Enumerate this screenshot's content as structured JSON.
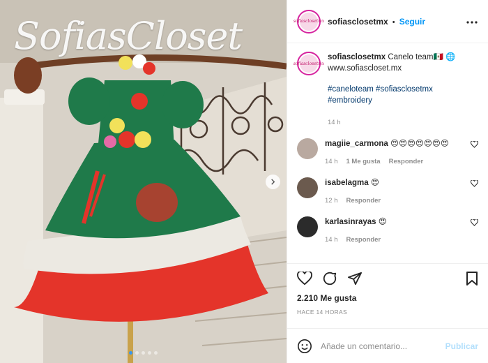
{
  "post": {
    "watermark": "SofiasCloset",
    "username": "sofiasclosetmx",
    "follow_label": "Seguir",
    "separator": "•",
    "avatar_text": "sofiasclosetmx",
    "caption": {
      "username": "sofiasclosetmx",
      "text": "Canelo team🇲🇽 🌐www.sofiascloset.mx",
      "hashtags": "#caneloteam #sofiasclosetmx #embroidery",
      "time": "14 h"
    },
    "comments": [
      {
        "username": "magiie_carmona",
        "text": "😍😍😍😍😍😍😍",
        "time": "14 h",
        "likes": "1 Me gusta",
        "reply": "Responder",
        "avatar_color": "#b9a9a0"
      },
      {
        "username": "isabelagma",
        "text": "😍",
        "time": "12 h",
        "reply": "Responder",
        "avatar_color": "#6b5a4e"
      },
      {
        "username": "karlasinrayas",
        "text": "😍",
        "time": "14 h",
        "reply": "Responder",
        "avatar_color": "#2b2b2b"
      }
    ],
    "likes": "2.210 Me gusta",
    "ago": "HACE 14 HORAS",
    "add_comment_placeholder": "Añade un comentario...",
    "publish_label": "Publicar",
    "carousel": {
      "count": 5,
      "active_index": 0
    },
    "icons": {
      "like": "heart-icon",
      "comment": "comment-icon",
      "share": "share-icon",
      "save": "bookmark-icon",
      "emoji": "emoji-icon",
      "more": "more-options-icon",
      "next": "chevron-right-icon"
    },
    "colors": {
      "accent": "#0095f6",
      "dress_green": "#1f7a4a",
      "dress_red": "#e4342a",
      "dress_white": "#ece9e2"
    }
  }
}
